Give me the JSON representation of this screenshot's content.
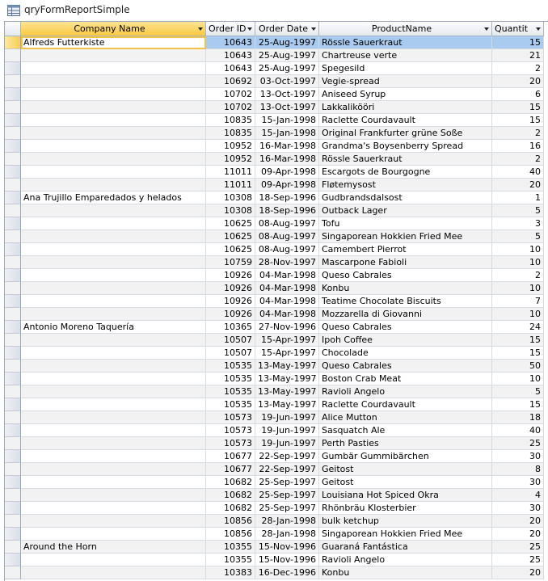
{
  "window": {
    "title": "qryFormReportSimple",
    "icon": "query-datasheet-icon"
  },
  "columns": [
    {
      "label": "Company Name"
    },
    {
      "label": "Order ID"
    },
    {
      "label": "Order Date"
    },
    {
      "label": "ProductName"
    },
    {
      "label": "Quantit"
    }
  ],
  "rows": [
    {
      "company": "Alfreds Futterkiste",
      "order_id": "10643",
      "date": "25-Aug-1997",
      "product": "Rössle Sauerkraut",
      "qty": "15"
    },
    {
      "company": "",
      "order_id": "10643",
      "date": "25-Aug-1997",
      "product": "Chartreuse verte",
      "qty": "21"
    },
    {
      "company": "",
      "order_id": "10643",
      "date": "25-Aug-1997",
      "product": "Spegesild",
      "qty": "2"
    },
    {
      "company": "",
      "order_id": "10692",
      "date": "03-Oct-1997",
      "product": "Vegie-spread",
      "qty": "20"
    },
    {
      "company": "",
      "order_id": "10702",
      "date": "13-Oct-1997",
      "product": "Aniseed Syrup",
      "qty": "6"
    },
    {
      "company": "",
      "order_id": "10702",
      "date": "13-Oct-1997",
      "product": "Lakkalikööri",
      "qty": "15"
    },
    {
      "company": "",
      "order_id": "10835",
      "date": "15-Jan-1998",
      "product": "Raclette Courdavault",
      "qty": "15"
    },
    {
      "company": "",
      "order_id": "10835",
      "date": "15-Jan-1998",
      "product": "Original Frankfurter grüne Soße",
      "qty": "2"
    },
    {
      "company": "",
      "order_id": "10952",
      "date": "16-Mar-1998",
      "product": "Grandma's Boysenberry Spread",
      "qty": "16"
    },
    {
      "company": "",
      "order_id": "10952",
      "date": "16-Mar-1998",
      "product": "Rössle Sauerkraut",
      "qty": "2"
    },
    {
      "company": "",
      "order_id": "11011",
      "date": "09-Apr-1998",
      "product": "Escargots de Bourgogne",
      "qty": "40"
    },
    {
      "company": "",
      "order_id": "11011",
      "date": "09-Apr-1998",
      "product": "Fløtemysost",
      "qty": "20"
    },
    {
      "company": "Ana Trujillo Emparedados y helados",
      "order_id": "10308",
      "date": "18-Sep-1996",
      "product": "Gudbrandsdalsost",
      "qty": "1"
    },
    {
      "company": "",
      "order_id": "10308",
      "date": "18-Sep-1996",
      "product": "Outback Lager",
      "qty": "5"
    },
    {
      "company": "",
      "order_id": "10625",
      "date": "08-Aug-1997",
      "product": "Tofu",
      "qty": "3"
    },
    {
      "company": "",
      "order_id": "10625",
      "date": "08-Aug-1997",
      "product": "Singaporean Hokkien Fried Mee",
      "qty": "5"
    },
    {
      "company": "",
      "order_id": "10625",
      "date": "08-Aug-1997",
      "product": "Camembert Pierrot",
      "qty": "10"
    },
    {
      "company": "",
      "order_id": "10759",
      "date": "28-Nov-1997",
      "product": "Mascarpone Fabioli",
      "qty": "10"
    },
    {
      "company": "",
      "order_id": "10926",
      "date": "04-Mar-1998",
      "product": "Queso Cabrales",
      "qty": "2"
    },
    {
      "company": "",
      "order_id": "10926",
      "date": "04-Mar-1998",
      "product": "Konbu",
      "qty": "10"
    },
    {
      "company": "",
      "order_id": "10926",
      "date": "04-Mar-1998",
      "product": "Teatime Chocolate Biscuits",
      "qty": "7"
    },
    {
      "company": "",
      "order_id": "10926",
      "date": "04-Mar-1998",
      "product": "Mozzarella di Giovanni",
      "qty": "10"
    },
    {
      "company": "Antonio Moreno Taquería",
      "order_id": "10365",
      "date": "27-Nov-1996",
      "product": "Queso Cabrales",
      "qty": "24"
    },
    {
      "company": "",
      "order_id": "10507",
      "date": "15-Apr-1997",
      "product": "Ipoh Coffee",
      "qty": "15"
    },
    {
      "company": "",
      "order_id": "10507",
      "date": "15-Apr-1997",
      "product": "Chocolade",
      "qty": "15"
    },
    {
      "company": "",
      "order_id": "10535",
      "date": "13-May-1997",
      "product": "Queso Cabrales",
      "qty": "50"
    },
    {
      "company": "",
      "order_id": "10535",
      "date": "13-May-1997",
      "product": "Boston Crab Meat",
      "qty": "10"
    },
    {
      "company": "",
      "order_id": "10535",
      "date": "13-May-1997",
      "product": "Ravioli Angelo",
      "qty": "5"
    },
    {
      "company": "",
      "order_id": "10535",
      "date": "13-May-1997",
      "product": "Raclette Courdavault",
      "qty": "15"
    },
    {
      "company": "",
      "order_id": "10573",
      "date": "19-Jun-1997",
      "product": "Alice Mutton",
      "qty": "18"
    },
    {
      "company": "",
      "order_id": "10573",
      "date": "19-Jun-1997",
      "product": "Sasquatch Ale",
      "qty": "40"
    },
    {
      "company": "",
      "order_id": "10573",
      "date": "19-Jun-1997",
      "product": "Perth Pasties",
      "qty": "25"
    },
    {
      "company": "",
      "order_id": "10677",
      "date": "22-Sep-1997",
      "product": "Gumbär Gummibärchen",
      "qty": "30"
    },
    {
      "company": "",
      "order_id": "10677",
      "date": "22-Sep-1997",
      "product": "Geitost",
      "qty": "8"
    },
    {
      "company": "",
      "order_id": "10682",
      "date": "25-Sep-1997",
      "product": "Geitost",
      "qty": "30"
    },
    {
      "company": "",
      "order_id": "10682",
      "date": "25-Sep-1997",
      "product": "Louisiana Hot Spiced Okra",
      "qty": "4"
    },
    {
      "company": "",
      "order_id": "10682",
      "date": "25-Sep-1997",
      "product": "Rhönbräu Klosterbier",
      "qty": "30"
    },
    {
      "company": "",
      "order_id": "10856",
      "date": "28-Jan-1998",
      "product": "bulk ketchup",
      "qty": "20"
    },
    {
      "company": "",
      "order_id": "10856",
      "date": "28-Jan-1998",
      "product": "Singaporean Hokkien Fried Mee",
      "qty": "20"
    },
    {
      "company": "Around the Horn",
      "order_id": "10355",
      "date": "15-Nov-1996",
      "product": "Guaraná Fantástica",
      "qty": "25"
    },
    {
      "company": "",
      "order_id": "10355",
      "date": "15-Nov-1996",
      "product": "Ravioli Angelo",
      "qty": "25"
    },
    {
      "company": "",
      "order_id": "10383",
      "date": "16-Dec-1996",
      "product": "Konbu",
      "qty": "20"
    }
  ]
}
